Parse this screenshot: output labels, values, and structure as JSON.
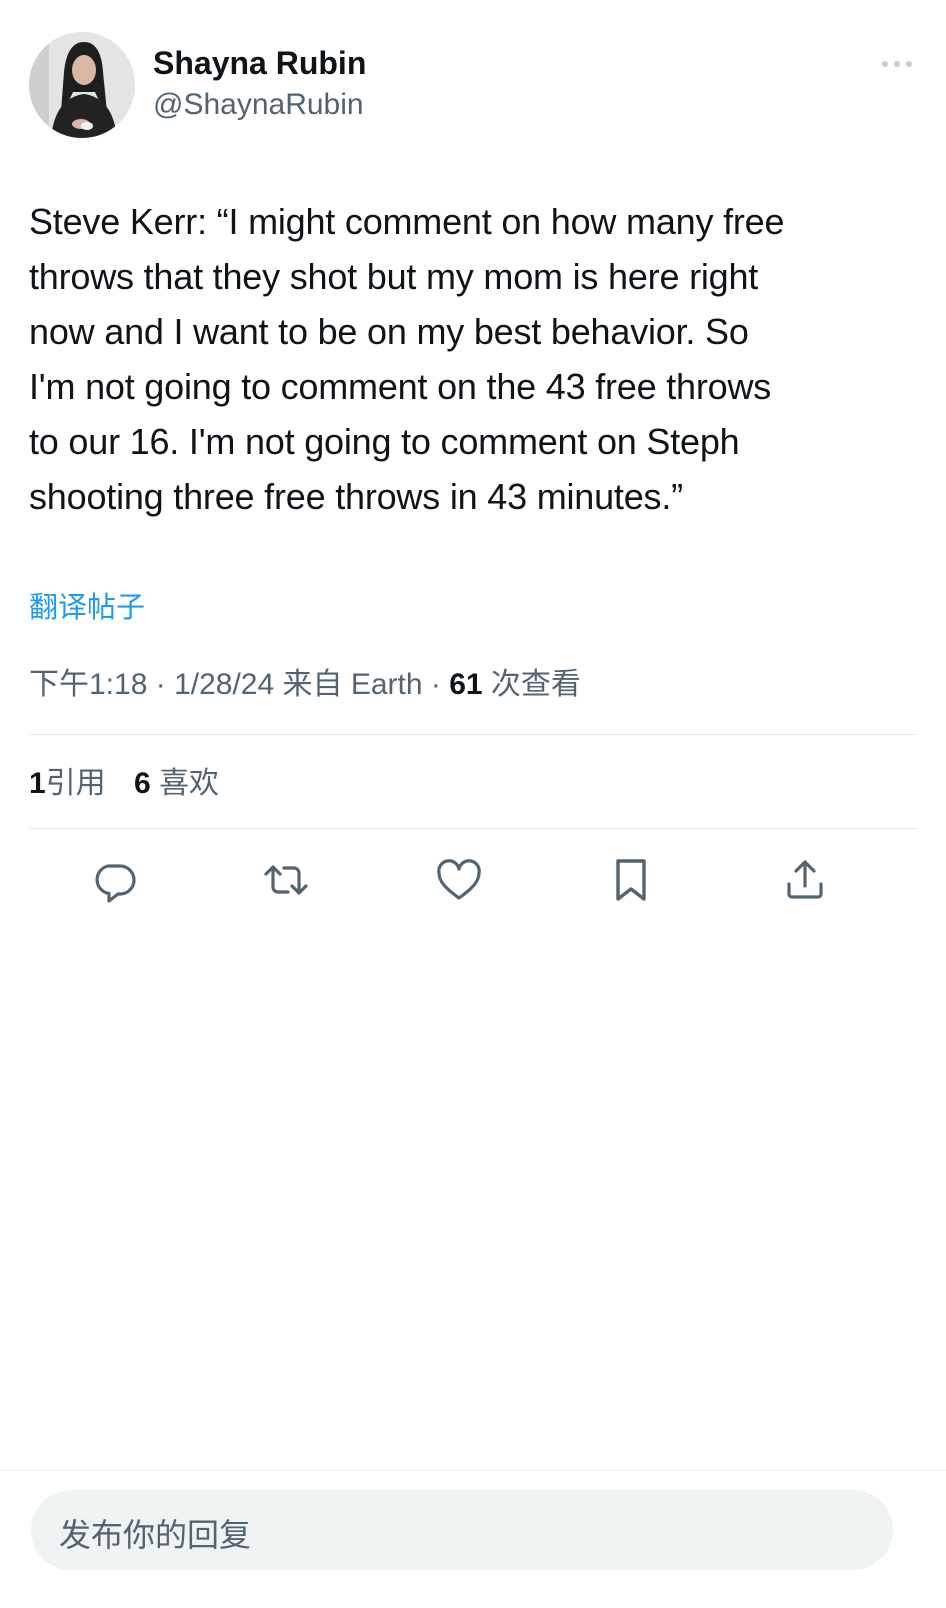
{
  "author": {
    "display_name": "Shayna Rubin",
    "handle": "@ShaynaRubin"
  },
  "tweet": {
    "lines": [
      "Steve Kerr: “I might comment on how many free",
      "throws that they shot but my mom is here right",
      "now and I want to be on my best behavior. So",
      "I'm not going to comment on the 43 free throws",
      "to our 16. I'm not going to comment on Steph",
      "shooting three free throws in 43 minutes.”"
    ],
    "translate_label": "翻译帖子"
  },
  "meta": {
    "time": "下午1:18",
    "separator1": " · ",
    "date": "1/28/24",
    "source": " 来自 Earth",
    "separator2": " · ",
    "views_count": "61",
    "views_label": " 次查看"
  },
  "stats": {
    "quotes_count": "1",
    "quotes_label": "引用",
    "likes_count": "6",
    "likes_label": "喜欢"
  },
  "actions": {
    "icons": [
      "reply-icon",
      "retweet-icon",
      "like-icon",
      "bookmark-icon",
      "share-icon"
    ]
  },
  "reply": {
    "placeholder": "发布你的回复"
  },
  "colors": {
    "text_primary": "#0f1419",
    "text_secondary": "#536471",
    "link": "#1d9bf0",
    "divider": "#e6e9eb",
    "reply_bg": "#eff3f4"
  }
}
